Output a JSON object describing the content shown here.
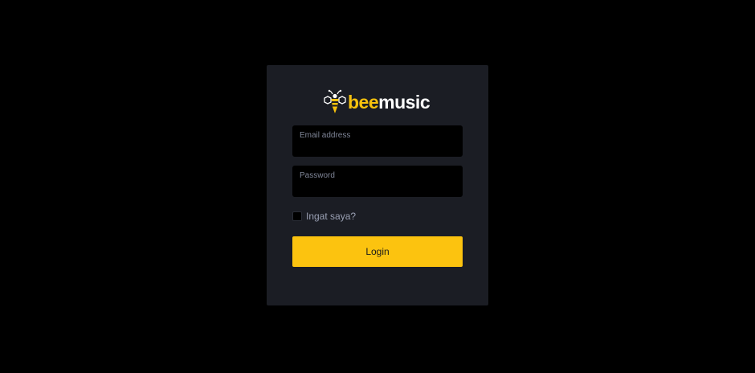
{
  "brand": {
    "name_part1": "bee",
    "name_part2": "music",
    "accent_color": "#f7c20d",
    "logo_icon": "bee-icon"
  },
  "form": {
    "email": {
      "label": "Email address",
      "value": ""
    },
    "password": {
      "label": "Password",
      "value": ""
    },
    "remember": {
      "label": "Ingat saya?",
      "checked": false
    },
    "submit_label": "Login",
    "submit_color": "#fcc30f"
  },
  "colors": {
    "background": "#000000",
    "card": "#1b1d24"
  }
}
